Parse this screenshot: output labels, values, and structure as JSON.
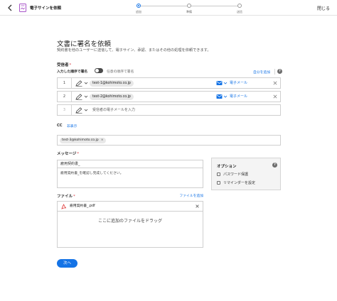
{
  "header": {
    "app_title": "電子サインを依頼",
    "close_label": "閉じる",
    "steps": [
      {
        "label": "追加",
        "active": true
      },
      {
        "label": "準備",
        "active": false
      },
      {
        "label": "送信",
        "active": false
      }
    ]
  },
  "page": {
    "title": "文書に署名を依頼",
    "subtitle": "契約書を他のユーザーに送信して、電子サイン、承認、またはその他の処理を依頼できます。"
  },
  "recipients": {
    "label": "受信者",
    "required_mark": "*",
    "order_label": "入力した順序で署名",
    "order_toggle_on": true,
    "order_toggle_text": "任意の順序で署名",
    "add_self_label": "自分を追加",
    "help_icon": "help-icon",
    "rows": [
      {
        "number": "1",
        "email": "test-1@kohimoto.co.jp",
        "method": "電子メール"
      },
      {
        "number": "2",
        "email": "test-2@kohimoto.co.jp",
        "method": "電子メール"
      }
    ],
    "new_row": {
      "number": "3",
      "placeholder": "受信者の電子メールを入力"
    }
  },
  "cc": {
    "label": "CC",
    "toggle_label": "非表示",
    "emails": [
      "test-3@kohimoto.co.jp"
    ],
    "remove_symbol": "×"
  },
  "message": {
    "label": "メッセージ",
    "required_mark": "*",
    "title_value": "雇用契約書_",
    "body_value": "雇用契約書_を確認し完成してください。"
  },
  "options": {
    "title": "オプション",
    "items": [
      {
        "label": "パスワード保護",
        "checked": false
      },
      {
        "label": "リマインダーを設定",
        "checked": false
      }
    ]
  },
  "files": {
    "label": "ファイル",
    "required_mark": "*",
    "add_label": "ファイルを追加",
    "items": [
      {
        "name": "雇用契約書_.pdf"
      }
    ],
    "drop_text": "ここに追加のファイルをドラッグ"
  },
  "next_label": "次へ",
  "colors": {
    "accent": "#1473e6",
    "required": "#d7373f",
    "chip_bg": "#e8e8e8",
    "options_bg": "#f4f4f4"
  }
}
